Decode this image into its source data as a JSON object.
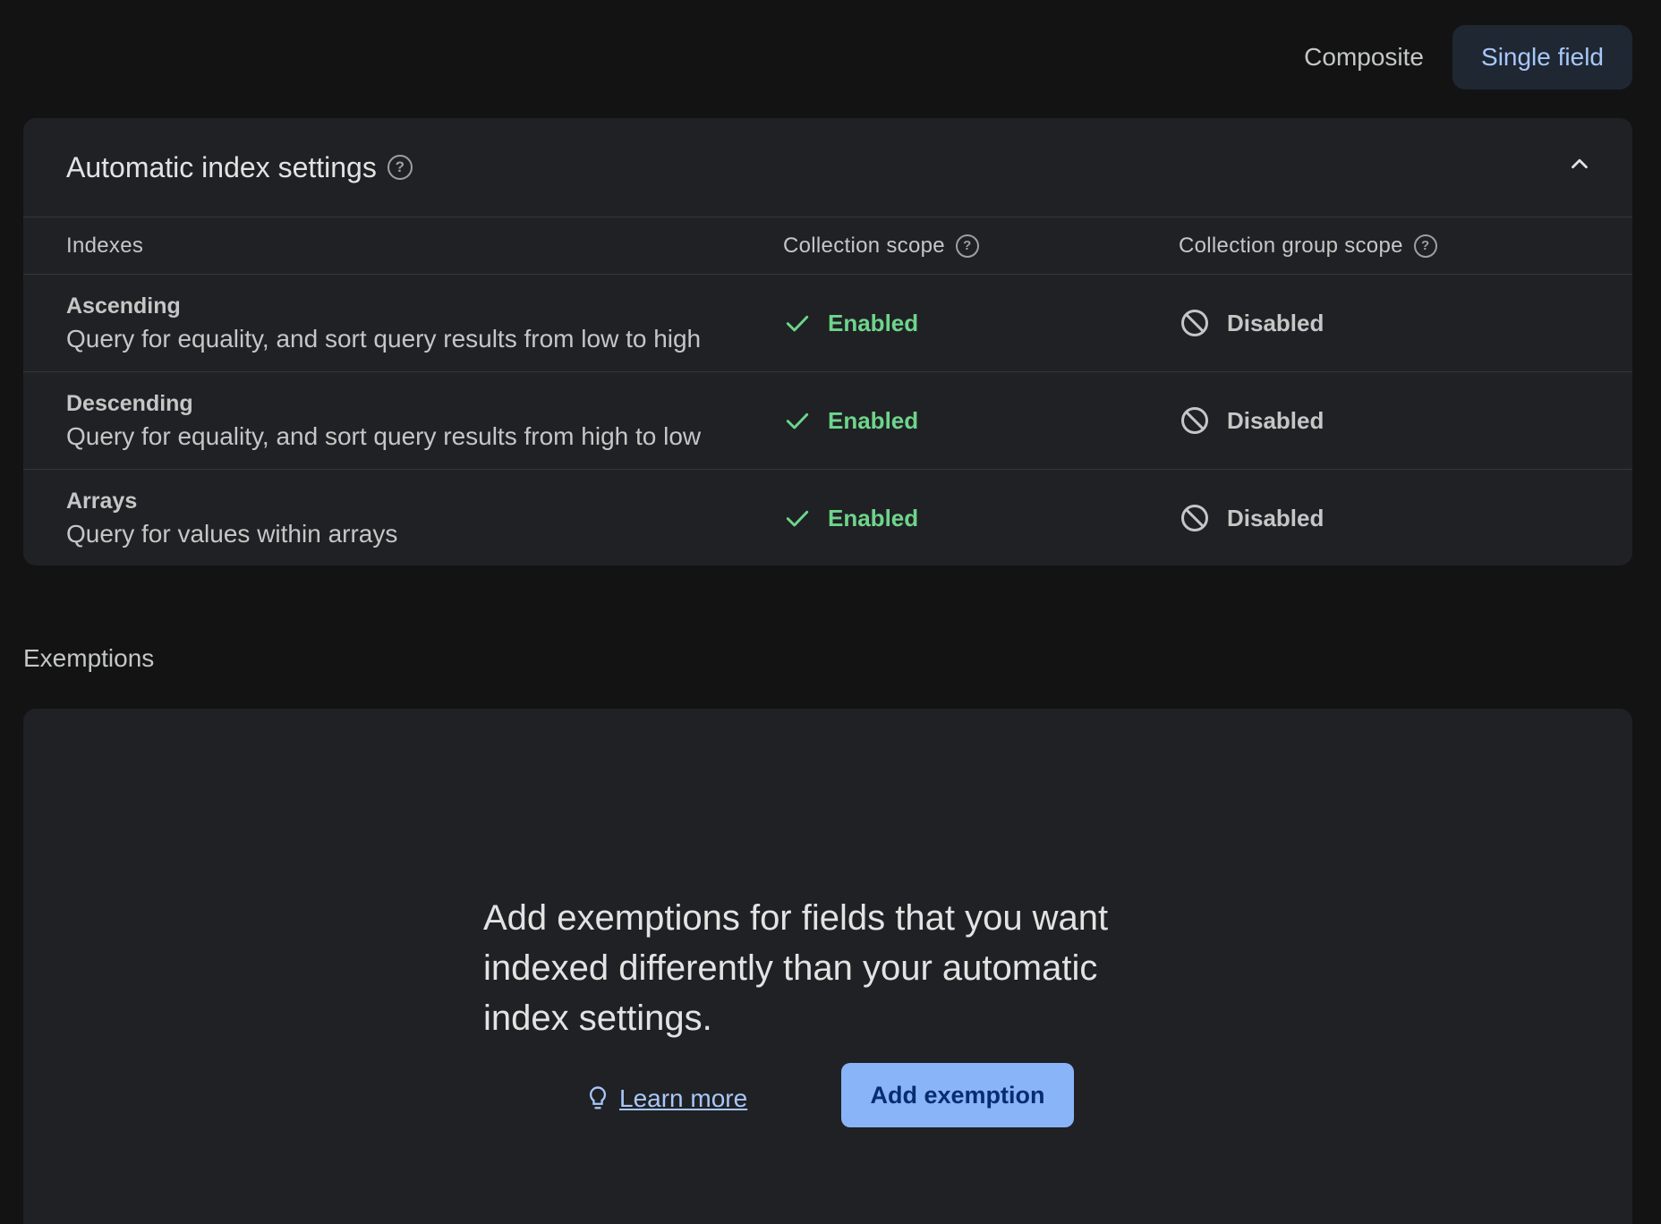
{
  "toggle": {
    "composite_label": "Composite",
    "single_field_label": "Single field",
    "active": "Single field"
  },
  "settings": {
    "title": "Automatic index settings",
    "columns": {
      "indexes": "Indexes",
      "collection_scope": "Collection scope",
      "collection_group_scope": "Collection group scope"
    },
    "rows": [
      {
        "title": "Ascending",
        "description": "Query for equality, and sort query results from low to high",
        "collection": "Enabled",
        "collection_group": "Disabled"
      },
      {
        "title": "Descending",
        "description": "Query for equality, and sort query results from high to low",
        "collection": "Enabled",
        "collection_group": "Disabled"
      },
      {
        "title": "Arrays",
        "description": "Query for values within arrays",
        "collection": "Enabled",
        "collection_group": "Disabled"
      }
    ]
  },
  "exemptions": {
    "section_label": "Exemptions",
    "empty_text": "Add exemptions for fields that you want indexed differently than your automatic index settings.",
    "learn_more_label": "Learn more",
    "add_button_label": "Add exemption"
  },
  "colors": {
    "background": "#131314",
    "card": "#202124",
    "enabled": "#6dd58c",
    "accent": "#8ab4f8",
    "link": "#a8c7fa"
  }
}
